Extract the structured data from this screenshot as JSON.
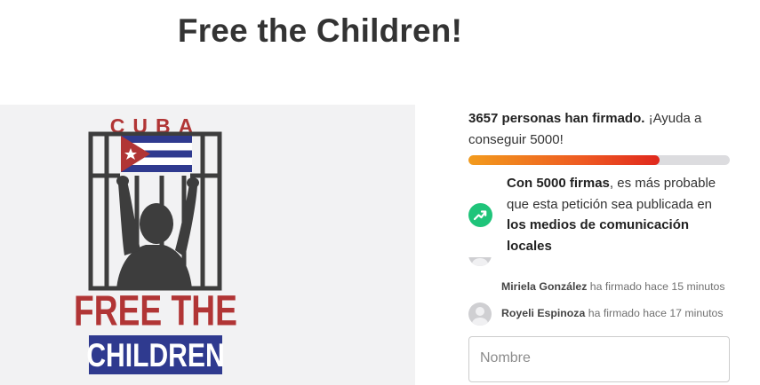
{
  "page": {
    "title": "Free the Children!"
  },
  "hero": {
    "logo_top_text": "CUBA",
    "logo_line1": "FREE THE",
    "logo_line2": "CHILDREN",
    "colors": {
      "red": "#b13535",
      "blue": "#2f3a8f",
      "dark": "#3d3d3d",
      "background": "#f2f2f3"
    }
  },
  "stats": {
    "signed_count_label": "3657 personas han firmado.",
    "goal_label": "¡Ayuda a conseguir 5000!",
    "signed": 3657,
    "goal": 5000,
    "progress_fraction": 0.7314
  },
  "promo": {
    "icon": "trending-up-icon",
    "bold1": "Con 5000 firmas",
    "text1": ", es más probable que esta petición sea publicada en ",
    "bold2": "los medios de comunicación locales",
    "color": "#1fc47a"
  },
  "signers": [
    {
      "name": "Miriela González",
      "action": "ha firmado hace 15 minutos"
    },
    {
      "name": "Royeli Espinoza",
      "action": "ha firmado hace 17 minutos"
    }
  ],
  "form": {
    "name_placeholder": "Nombre"
  }
}
